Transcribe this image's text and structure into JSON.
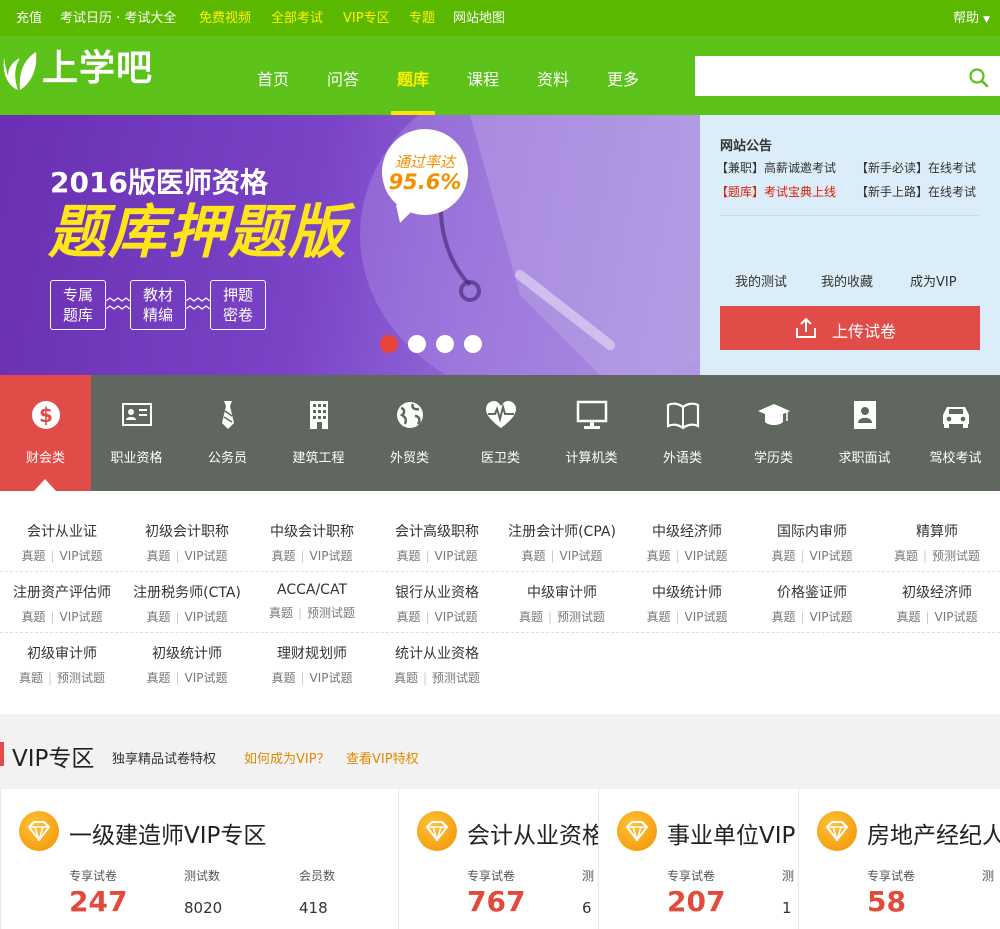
{
  "topbar": {
    "links": [
      {
        "label": "充值",
        "color": "#ffffff"
      },
      {
        "label": "考试日历 · 考试大全",
        "color": "#ffffff"
      },
      {
        "label": "免费视频",
        "color": "#fff200"
      },
      {
        "label": "全部考试",
        "color": "#fff200"
      },
      {
        "label": "VIP专区",
        "color": "#fff200"
      },
      {
        "label": "专题",
        "color": "#fff200"
      },
      {
        "label": "网站地图",
        "color": "#ffffff"
      }
    ],
    "help": "帮助"
  },
  "header": {
    "logo_text": "上学吧",
    "nav": [
      "首页",
      "问答",
      "题库",
      "课程",
      "资料",
      "更多"
    ],
    "active_nav": "题库",
    "search_placeholder": ""
  },
  "banner": {
    "title_line1": "2016版医师资格",
    "title_line2": "题库押题版",
    "badge_line1": "通过率达",
    "badge_line2": "95.6%",
    "features": [
      {
        "l1": "专属",
        "l2": "题库"
      },
      {
        "l1": "教材",
        "l2": "精编"
      },
      {
        "l1": "押题",
        "l2": "密卷"
      }
    ],
    "slides": 4,
    "active_slide": 0
  },
  "notice": {
    "title": "网站公告",
    "items": [
      {
        "text": "【兼职】高薪诚邀考试",
        "color": "#333333"
      },
      {
        "text": "【新手必读】在线考试",
        "color": "#333333"
      },
      {
        "text": "【题库】考试宝典上线",
        "color": "#d81e06"
      },
      {
        "text": "【新手上路】在线考试",
        "color": "#333333"
      }
    ],
    "links": [
      "我的测试",
      "我的收藏",
      "成为VIP"
    ],
    "upload_button": "上传试卷"
  },
  "categories": [
    {
      "label": "财会类",
      "icon": "dollar-icon",
      "active": true
    },
    {
      "label": "职业资格",
      "icon": "id-card-icon"
    },
    {
      "label": "公务员",
      "icon": "tie-icon"
    },
    {
      "label": "建筑工程",
      "icon": "building-icon"
    },
    {
      "label": "外贸类",
      "icon": "globe-icon"
    },
    {
      "label": "医卫类",
      "icon": "heart-pulse-icon"
    },
    {
      "label": "计算机类",
      "icon": "monitor-icon"
    },
    {
      "label": "外语类",
      "icon": "book-icon"
    },
    {
      "label": "学历类",
      "icon": "graduation-cap-icon"
    },
    {
      "label": "求职面试",
      "icon": "person-card-icon"
    },
    {
      "label": "驾校考试",
      "icon": "car-icon"
    }
  ],
  "subjects": [
    {
      "name": "会计从业证",
      "links": [
        "真题",
        "VIP试题"
      ]
    },
    {
      "name": "初级会计职称",
      "links": [
        "真题",
        "VIP试题"
      ]
    },
    {
      "name": "中级会计职称",
      "links": [
        "真题",
        "VIP试题"
      ]
    },
    {
      "name": "会计高级职称",
      "links": [
        "真题",
        "VIP试题"
      ]
    },
    {
      "name": "注册会计师(CPA)",
      "links": [
        "真题",
        "VIP试题"
      ]
    },
    {
      "name": "中级经济师",
      "links": [
        "真题",
        "VIP试题"
      ]
    },
    {
      "name": "国际内审师",
      "links": [
        "真题",
        "VIP试题"
      ]
    },
    {
      "name": "精算师",
      "links": [
        "真题",
        "预测试题"
      ]
    },
    {
      "name": "注册资产评估师",
      "links": [
        "真题",
        "VIP试题"
      ]
    },
    {
      "name": "注册税务师(CTA)",
      "links": [
        "真题",
        "VIP试题"
      ]
    },
    {
      "name": "ACCA/CAT",
      "links": [
        "真题",
        "预测试题"
      ]
    },
    {
      "name": "银行从业资格",
      "links": [
        "真题",
        "VIP试题"
      ]
    },
    {
      "name": "中级审计师",
      "links": [
        "真题",
        "预测试题"
      ]
    },
    {
      "name": "中级统计师",
      "links": [
        "真题",
        "VIP试题"
      ]
    },
    {
      "name": "价格鉴证师",
      "links": [
        "真题",
        "VIP试题"
      ]
    },
    {
      "name": "初级经济师",
      "links": [
        "真题",
        "VIP试题"
      ]
    },
    {
      "name": "初级审计师",
      "links": [
        "真题",
        "预测试题"
      ]
    },
    {
      "name": "初级统计师",
      "links": [
        "真题",
        "VIP试题"
      ]
    },
    {
      "name": "理财规划师",
      "links": [
        "真题",
        "VIP试题"
      ]
    },
    {
      "name": "统计从业资格",
      "links": [
        "真题",
        "预测试题"
      ]
    }
  ],
  "vip": {
    "title": "VIP专区",
    "subtitle": "独享精品试卷特权",
    "link1": "如何成为VIP？",
    "link2": "查看VIP特权",
    "cards": [
      {
        "title": "一级建造师VIP专区",
        "stat_labels": [
          "专享试卷",
          "测试数",
          "会员数"
        ],
        "stat_values": [
          "247",
          "8020",
          "418"
        ]
      },
      {
        "title": "会计从业资格",
        "stat_labels": [
          "专享试卷",
          "测"
        ],
        "stat_values": [
          "767",
          "6"
        ]
      },
      {
        "title": "事业单位VIP",
        "stat_labels": [
          "专享试卷",
          "测"
        ],
        "stat_values": [
          "207",
          "1"
        ]
      },
      {
        "title": "房地产经纪人",
        "stat_labels": [
          "专享试卷",
          "测"
        ],
        "stat_values": [
          "58",
          ""
        ]
      }
    ]
  }
}
